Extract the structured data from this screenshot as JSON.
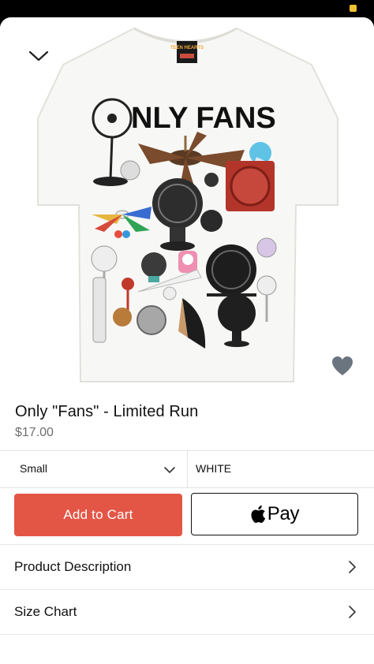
{
  "product": {
    "title": "Only \"Fans\" - Limited Run",
    "price": "$17.00",
    "image": {
      "shirt_print_title": "NLY FANS",
      "shirt_tag_text": "TEEN HEARTS"
    }
  },
  "variants": {
    "size": "Small",
    "color": "WHITE"
  },
  "actions": {
    "add_to_cart_label": "Add to Cart",
    "apple_pay_label": "Pay"
  },
  "rows": {
    "description_label": "Product Description",
    "size_chart_label": "Size Chart"
  },
  "colors": {
    "accent": "#e35646",
    "favorite": "#6b7580",
    "status_battery": "#f2c230"
  }
}
